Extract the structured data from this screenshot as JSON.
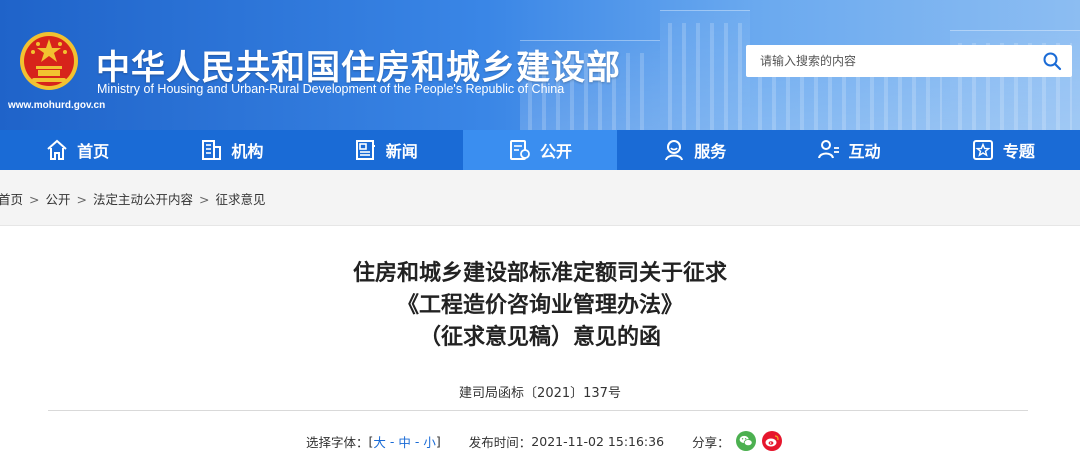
{
  "header": {
    "title": "中华人民共和国住房和城乡建设部",
    "subtitle": "Ministry of Housing and Urban-Rural Development of the People's Republic of China",
    "url": "www.mohurd.gov.cn",
    "colors": {
      "primary": "#1a6bd6",
      "active": "#3a8ef0",
      "emblem_red": "#d7231b",
      "emblem_gold": "#f2c230"
    }
  },
  "search": {
    "placeholder": "请输入搜索的内容",
    "icon": "search-icon"
  },
  "nav": {
    "items": [
      {
        "label": "首页",
        "icon": "home-icon",
        "active": false
      },
      {
        "label": "机构",
        "icon": "building-icon",
        "active": false
      },
      {
        "label": "新闻",
        "icon": "news-icon",
        "active": false
      },
      {
        "label": "公开",
        "icon": "disclosure-icon",
        "active": true
      },
      {
        "label": "服务",
        "icon": "service-icon",
        "active": false
      },
      {
        "label": "互动",
        "icon": "interaction-icon",
        "active": false
      },
      {
        "label": "专题",
        "icon": "topic-icon",
        "active": false
      }
    ]
  },
  "breadcrumb": {
    "items": [
      "首页",
      "公开",
      "法定主动公开内容",
      "征求意见"
    ],
    "separator": ">"
  },
  "article": {
    "title_lines": [
      "住房和城乡建设部标准定额司关于征求",
      "《工程造价咨询业管理办法》",
      "（征求意见稿）意见的函"
    ],
    "doc_number": "建司局函标〔2021〕137号"
  },
  "meta": {
    "font_size_label": "选择字体：",
    "bracket_open": "[",
    "size_large": "大",
    "dash1": " - ",
    "size_medium": "中",
    "dash2": " - ",
    "size_small": "小",
    "bracket_close": "]",
    "publish_label": "发布时间：",
    "publish_time": "2021-11-02 15:16:36",
    "share_label": "分享：",
    "share_icons": [
      "wechat-icon",
      "weibo-icon"
    ]
  }
}
